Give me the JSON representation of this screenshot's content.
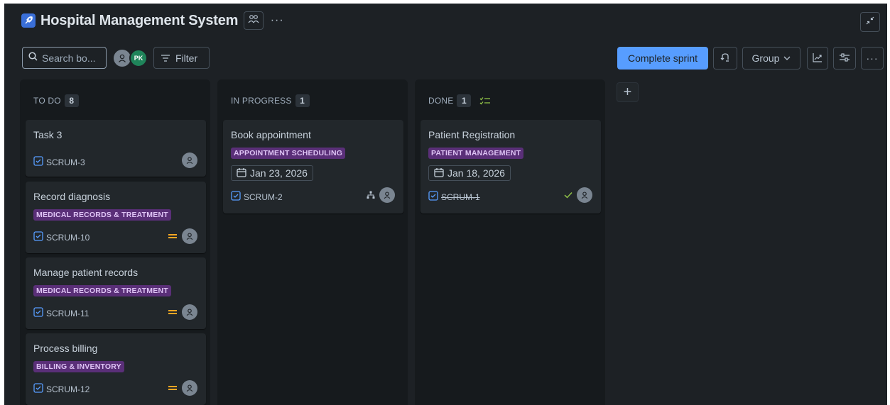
{
  "project": {
    "title": "Hospital Management System",
    "rocket_icon": "rocket-icon",
    "team_icon": "people-icon",
    "more_label": "···"
  },
  "toolbar": {
    "search_placeholder": "Search bo...",
    "avatar_initials": "PK",
    "filter_label": "Filter",
    "complete_sprint_label": "Complete sprint",
    "group_label": "Group",
    "more_label": "···"
  },
  "columns": [
    {
      "name": "TO DO",
      "count": "8",
      "cards": [
        {
          "title": "Task 3",
          "key": "SCRUM-3"
        },
        {
          "title": "Record diagnosis",
          "label": "MEDICAL RECORDS & TREATMENT",
          "key": "SCRUM-10",
          "priority": "medium"
        },
        {
          "title": "Manage patient records",
          "label": "MEDICAL RECORDS & TREATMENT",
          "key": "SCRUM-11",
          "priority": "medium"
        },
        {
          "title": "Process billing",
          "label": "BILLING & INVENTORY",
          "key": "SCRUM-12",
          "priority": "medium"
        }
      ]
    },
    {
      "name": "IN PROGRESS",
      "count": "1",
      "cards": [
        {
          "title": "Book appointment",
          "label": "APPOINTMENT SCHEDULING",
          "date": "Jan 23, 2026",
          "key": "SCRUM-2"
        }
      ]
    },
    {
      "name": "DONE",
      "count": "1",
      "cards": [
        {
          "title": "Patient Registration",
          "label": "PATIENT MANAGEMENT",
          "date": "Jan 18, 2026",
          "key": "SCRUM-1"
        }
      ]
    }
  ],
  "add_column_label": "+",
  "colors": {
    "background": "#1d2125",
    "column": "#161a1d",
    "card": "#22272b",
    "primary_button": "#579dff",
    "label_bg": "#5a2f78",
    "label_text": "#dfc4f5",
    "priority_medium": "#f5a623",
    "done_check": "#94c748",
    "avatar_pk": "#1f845a"
  }
}
